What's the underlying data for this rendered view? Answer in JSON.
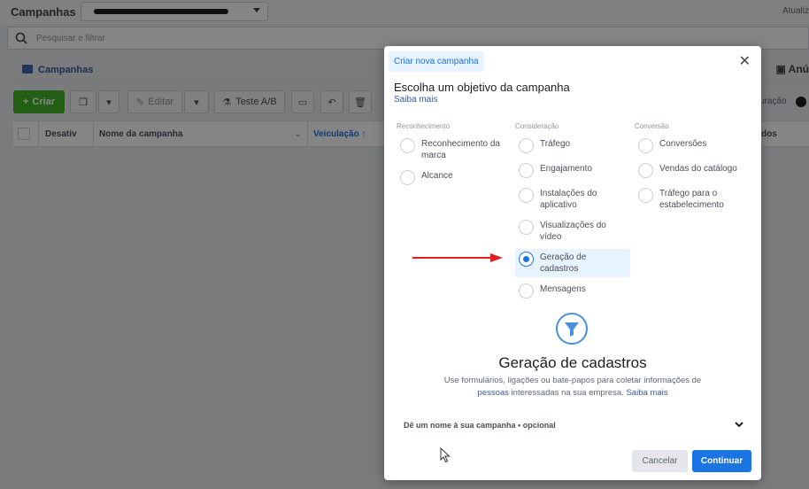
{
  "header": {
    "title": "Campanhas",
    "update_label": "Atualiz"
  },
  "search": {
    "placeholder": "Pesquisar e filtrar"
  },
  "tabs": {
    "campaigns": "Campanhas",
    "ads": "Anú"
  },
  "toolbar": {
    "create_label": "Criar",
    "edit_label": "Editar",
    "ab_test_label": "Teste A/B",
    "toggle_label": "uração"
  },
  "table": {
    "columns": [
      "Desativ",
      "Nome da campanha",
      "Veiculação ↑",
      "dos"
    ]
  },
  "modal": {
    "tag": "Criar nova campanha",
    "heading": "Escolha um objetivo da campanha",
    "learn_more": "Saiba mais",
    "columns": [
      {
        "title": "Reconhecimento",
        "options": [
          {
            "label": "Reconhecimento da marca",
            "selected": false
          },
          {
            "label": "Alcance",
            "selected": false
          }
        ]
      },
      {
        "title": "Consideração",
        "options": [
          {
            "label": "Tráfego",
            "selected": false
          },
          {
            "label": "Engajamento",
            "selected": false
          },
          {
            "label": "Instalações do aplicativo",
            "selected": false
          },
          {
            "label": "Visualizações do vídeo",
            "selected": false
          },
          {
            "label": "Geração de cadastros",
            "selected": true
          },
          {
            "label": "Mensagens",
            "selected": false
          }
        ]
      },
      {
        "title": "Conversão",
        "options": [
          {
            "label": "Conversões",
            "selected": false
          },
          {
            "label": "Vendas do catálogo",
            "selected": false
          },
          {
            "label": "Tráfego para o estabelecimento",
            "selected": false
          }
        ]
      }
    ],
    "detail": {
      "icon": "funnel-icon",
      "title": "Geração de cadastros",
      "desc_start": "Use formulários, ligações ou bate-papos para coletar informações de ",
      "desc_link": "pessoas",
      "desc_end": " interessadas na sua empresa. ",
      "desc_more": "Saiba mais"
    },
    "name_row_label": "Dê um nome à sua campanha • opcional",
    "cancel_label": "Cancelar",
    "continue_label": "Continuar"
  },
  "colors": {
    "accent": "#1b74e4",
    "create_green": "#42b72a",
    "annotation_arrow": "#e02020"
  }
}
